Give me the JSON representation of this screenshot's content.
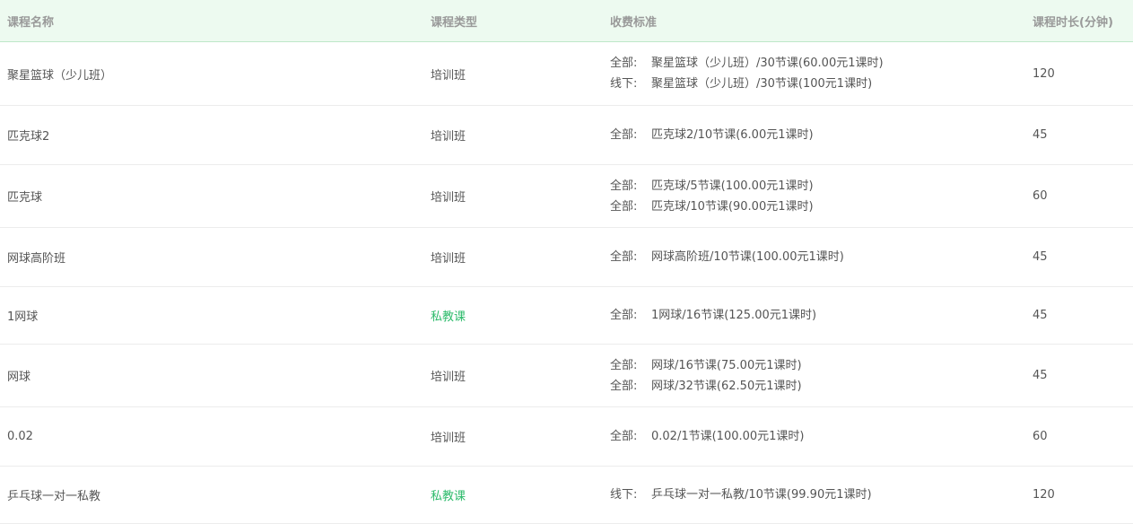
{
  "columns": [
    "课程名称",
    "课程类型",
    "收费标准",
    "课程时长(分钟)"
  ],
  "colors": {
    "header_bg": "#edfaf0",
    "private_type": "#2dbb6b",
    "text": "#555555"
  },
  "rows": [
    {
      "name": "聚星篮球（少儿班）",
      "type": "培训班",
      "private": false,
      "fees": [
        {
          "label": "全部:",
          "text": "聚星篮球（少儿班）/30节课(60.00元1课时)"
        },
        {
          "label": "线下:",
          "text": "聚星篮球（少儿班）/30节课(100元1课时)"
        }
      ],
      "duration": "120"
    },
    {
      "name": "匹克球2",
      "type": "培训班",
      "private": false,
      "fees": [
        {
          "label": "全部:",
          "text": "匹克球2/10节课(6.00元1课时)"
        }
      ],
      "duration": "45"
    },
    {
      "name": "匹克球",
      "type": "培训班",
      "private": false,
      "fees": [
        {
          "label": "全部:",
          "text": "匹克球/5节课(100.00元1课时)"
        },
        {
          "label": "全部:",
          "text": "匹克球/10节课(90.00元1课时)"
        }
      ],
      "duration": "60"
    },
    {
      "name": "网球高阶班",
      "type": "培训班",
      "private": false,
      "fees": [
        {
          "label": "全部:",
          "text": "网球高阶班/10节课(100.00元1课时)"
        }
      ],
      "duration": "45"
    },
    {
      "name": "1网球",
      "type": "私教课",
      "private": true,
      "fees": [
        {
          "label": "全部:",
          "text": "1网球/16节课(125.00元1课时)"
        }
      ],
      "duration": "45"
    },
    {
      "name": "网球",
      "type": "培训班",
      "private": false,
      "fees": [
        {
          "label": "全部:",
          "text": "网球/16节课(75.00元1课时)"
        },
        {
          "label": "全部:",
          "text": "网球/32节课(62.50元1课时)"
        }
      ],
      "duration": "45"
    },
    {
      "name": "0.02",
      "type": "培训班",
      "private": false,
      "fees": [
        {
          "label": "全部:",
          "text": "0.02/1节课(100.00元1课时)"
        }
      ],
      "duration": "60"
    },
    {
      "name": "乒乓球一对一私教",
      "type": "私教课",
      "private": true,
      "fees": [
        {
          "label": "线下:",
          "text": "乒乓球一对一私教/10节课(99.90元1课时)"
        }
      ],
      "duration": "120"
    }
  ]
}
